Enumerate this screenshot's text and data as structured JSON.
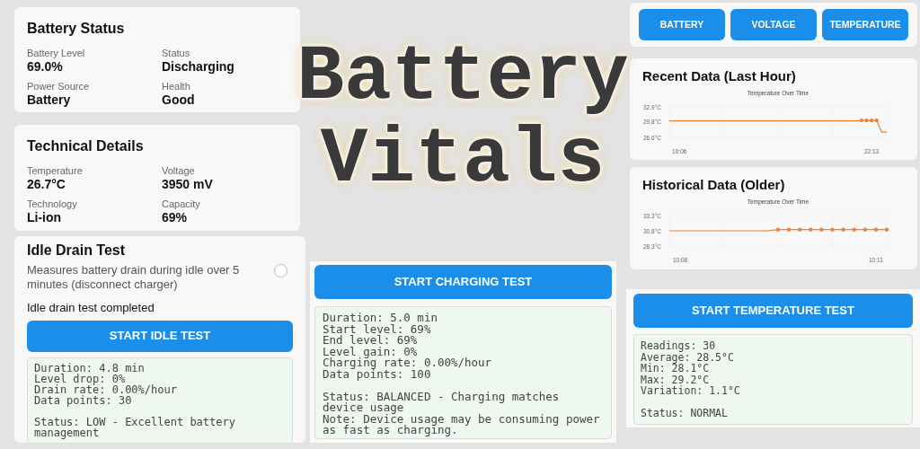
{
  "title": {
    "lines": [
      "Battery",
      "Vitals"
    ]
  },
  "battery_status": {
    "title": "Battery Status",
    "fields": [
      {
        "label": "Battery Level",
        "value": "69.0%"
      },
      {
        "label": "Status",
        "value": "Discharging"
      },
      {
        "label": "Power Source",
        "value": "Battery"
      },
      {
        "label": "Health",
        "value": "Good"
      }
    ]
  },
  "technical_details": {
    "title": "Technical Details",
    "fields": [
      {
        "label": "Temperature",
        "value": "26.7°C"
      },
      {
        "label": "Voltage",
        "value": "3950 mV"
      },
      {
        "label": "Technology",
        "value": "Li-ion"
      },
      {
        "label": "Capacity",
        "value": "69%"
      }
    ]
  },
  "idle_test": {
    "title": "Idle Drain Test",
    "description": "Measures battery drain during idle over 5 minutes (disconnect charger)",
    "checked": false,
    "message": "Idle drain test completed",
    "button": "START IDLE TEST",
    "result": [
      "Duration: 4.8 min",
      "Level drop: 0%",
      "Drain rate: 0.00%/hour",
      "Data points: 30"
    ],
    "status": [
      "Status: LOW - Excellent battery management"
    ]
  },
  "charging_test": {
    "button": "START CHARGING TEST",
    "result": [
      "Duration: 5.0 min",
      "Start level: 69%",
      "End level: 69%",
      "Level gain: 0%",
      "Charging rate: 0.00%/hour",
      "Data points: 100"
    ],
    "status": [
      "Status: BALANCED - Charging matches device usage",
      "Note: Device usage may be consuming power as fast as charging."
    ]
  },
  "chart_tabs": [
    {
      "label": "BATTERY"
    },
    {
      "label": "VOLTAGE"
    },
    {
      "label": "TEMPERATURE"
    }
  ],
  "recent": {
    "title": "Recent Data (Last Hour)",
    "chart_data": {
      "type": "line",
      "title": "Temperature Over Time",
      "categories": [
        null,
        null,
        "10:06",
        null,
        null,
        null,
        null,
        null,
        null,
        null,
        null,
        null,
        null,
        null,
        null,
        null,
        null,
        null,
        null,
        null,
        null,
        null,
        null,
        null,
        null,
        null,
        null,
        null,
        null,
        null,
        null,
        null,
        null,
        null,
        null,
        null,
        null,
        null,
        null,
        null,
        "22:13",
        null,
        null,
        null
      ],
      "series": [
        {
          "color": "#e8833a",
          "values": [
            30.0,
            30.0,
            30.0,
            30.0,
            30.0,
            30.0,
            30.0,
            30.0,
            30.0,
            30.0,
            30.0,
            30.0,
            30.0,
            30.0,
            30.0,
            30.0,
            30.0,
            30.0,
            30.0,
            30.0,
            30.0,
            30.0,
            30.0,
            30.0,
            30.0,
            30.0,
            30.0,
            30.0,
            30.0,
            30.0,
            30.0,
            30.0,
            30.0,
            30.0,
            30.0,
            30.0,
            30.0,
            30.0,
            30.1,
            30.1,
            30.1,
            30.1,
            27.7,
            27.7
          ]
        }
      ],
      "ylim": [
        26.6,
        32.9
      ],
      "yticks": [
        {
          "value": 26.6,
          "label": "26.6°C"
        },
        {
          "value": 29.8,
          "label": "29.8°C"
        },
        {
          "value": 32.9,
          "label": "32.9°C"
        }
      ]
    }
  },
  "historical": {
    "title": "Historical Data (Older)",
    "chart_data": {
      "type": "line",
      "title": "Temperature Over Time",
      "categories": [
        null,
        "10:08",
        null,
        null,
        null,
        null,
        null,
        null,
        null,
        null,
        null,
        null,
        null,
        null,
        null,
        null,
        null,
        null,
        null,
        "10:11",
        null
      ],
      "series": [
        {
          "color": "#e8833a",
          "values": [
            30.8,
            30.8,
            30.8,
            30.8,
            30.8,
            30.8,
            30.8,
            30.8,
            30.8,
            30.8,
            31.0,
            31.0,
            31.0,
            31.0,
            31.0,
            31.0,
            31.0,
            31.0,
            31.0,
            31.0,
            31.0
          ]
        }
      ],
      "ylim": [
        28.3,
        33.3
      ],
      "yticks": [
        {
          "value": 28.3,
          "label": "28.3°C"
        },
        {
          "value": 30.8,
          "label": "30.8°C"
        },
        {
          "value": 33.3,
          "label": "33.3°C"
        }
      ]
    }
  },
  "temperature_test": {
    "button": "START TEMPERATURE TEST",
    "result": [
      "Readings: 30",
      "Average: 28.5°C",
      "Min: 28.1°C",
      "Max: 29.2°C",
      "Variation: 1.1°C"
    ],
    "status": [
      "Status: NORMAL"
    ]
  }
}
